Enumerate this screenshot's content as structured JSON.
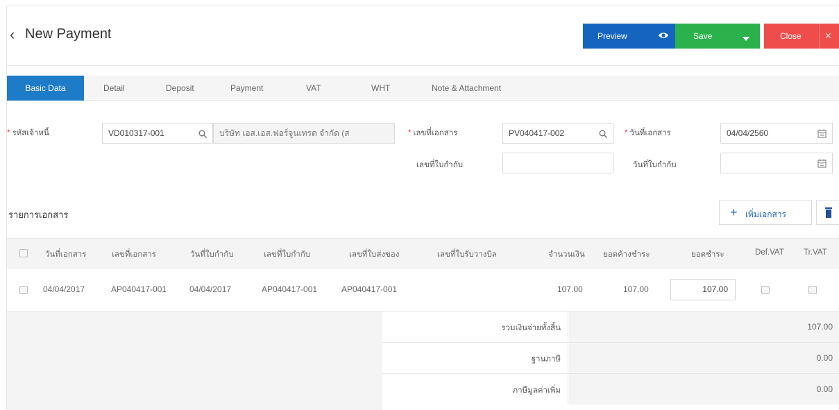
{
  "header": {
    "title": "New Payment",
    "preview_label": "Preview",
    "save_label": "Save",
    "close_label": "Close"
  },
  "tabs": [
    {
      "label": "Basic Data",
      "active": true
    },
    {
      "label": "Detail"
    },
    {
      "label": "Deposit"
    },
    {
      "label": "Payment"
    },
    {
      "label": "VAT"
    },
    {
      "label": "WHT"
    },
    {
      "label": "Note & Attachment"
    }
  ],
  "form": {
    "creditor_code_label": "รหัสเจ้าหนี้",
    "creditor_code_value": "VD010317-001",
    "creditor_name_value": "บริษัท เอส.เอส.ฟอร์จูนเทรด จำกัด (ส",
    "doc_no_label": "เลขที่เอกสาร",
    "doc_no_value": "PV040417-002",
    "doc_date_label": "วันที่เอกสาร",
    "doc_date_value": "04/04/2560",
    "invoice_no_label": "เลขที่ใบกำกับ",
    "invoice_no_value": "",
    "invoice_date_label": "วันที่ใบกำกับ",
    "invoice_date_value": ""
  },
  "documents": {
    "section_title": "รายการเอกสาร",
    "add_label": "เพิ่มเอกสาร",
    "columns": [
      "วันที่เอกสาร",
      "เลขที่เอกสาร",
      "วันที่ใบกำกับ",
      "เลขที่ใบกำกับ",
      "เลขที่ใบส่งของ",
      "เลขที่ใบรับวางบิล",
      "จำนวนเงิน",
      "ยอดค้างชำระ",
      "ยอดชำระ",
      "Def.VAT",
      "Tr.VAT"
    ],
    "rows": [
      {
        "doc_date": "04/04/2017",
        "doc_no": "AP040417-001",
        "invoice_date": "04/04/2017",
        "invoice_no": "AP040417-001",
        "delivery_no": "AP040417-001",
        "billing_no": "",
        "amount": "107.00",
        "outstanding": "107.00",
        "payment": "107.00"
      }
    ]
  },
  "summary": {
    "total_label": "รวมเงินจ่ายทั้งสิ้น",
    "total_value": "107.00",
    "tax_base_label": "ฐานภาษี",
    "tax_base_value": "0.00",
    "vat_label": "ภาษีมูลค่าเพิ่ม",
    "vat_value": "0.00"
  }
}
